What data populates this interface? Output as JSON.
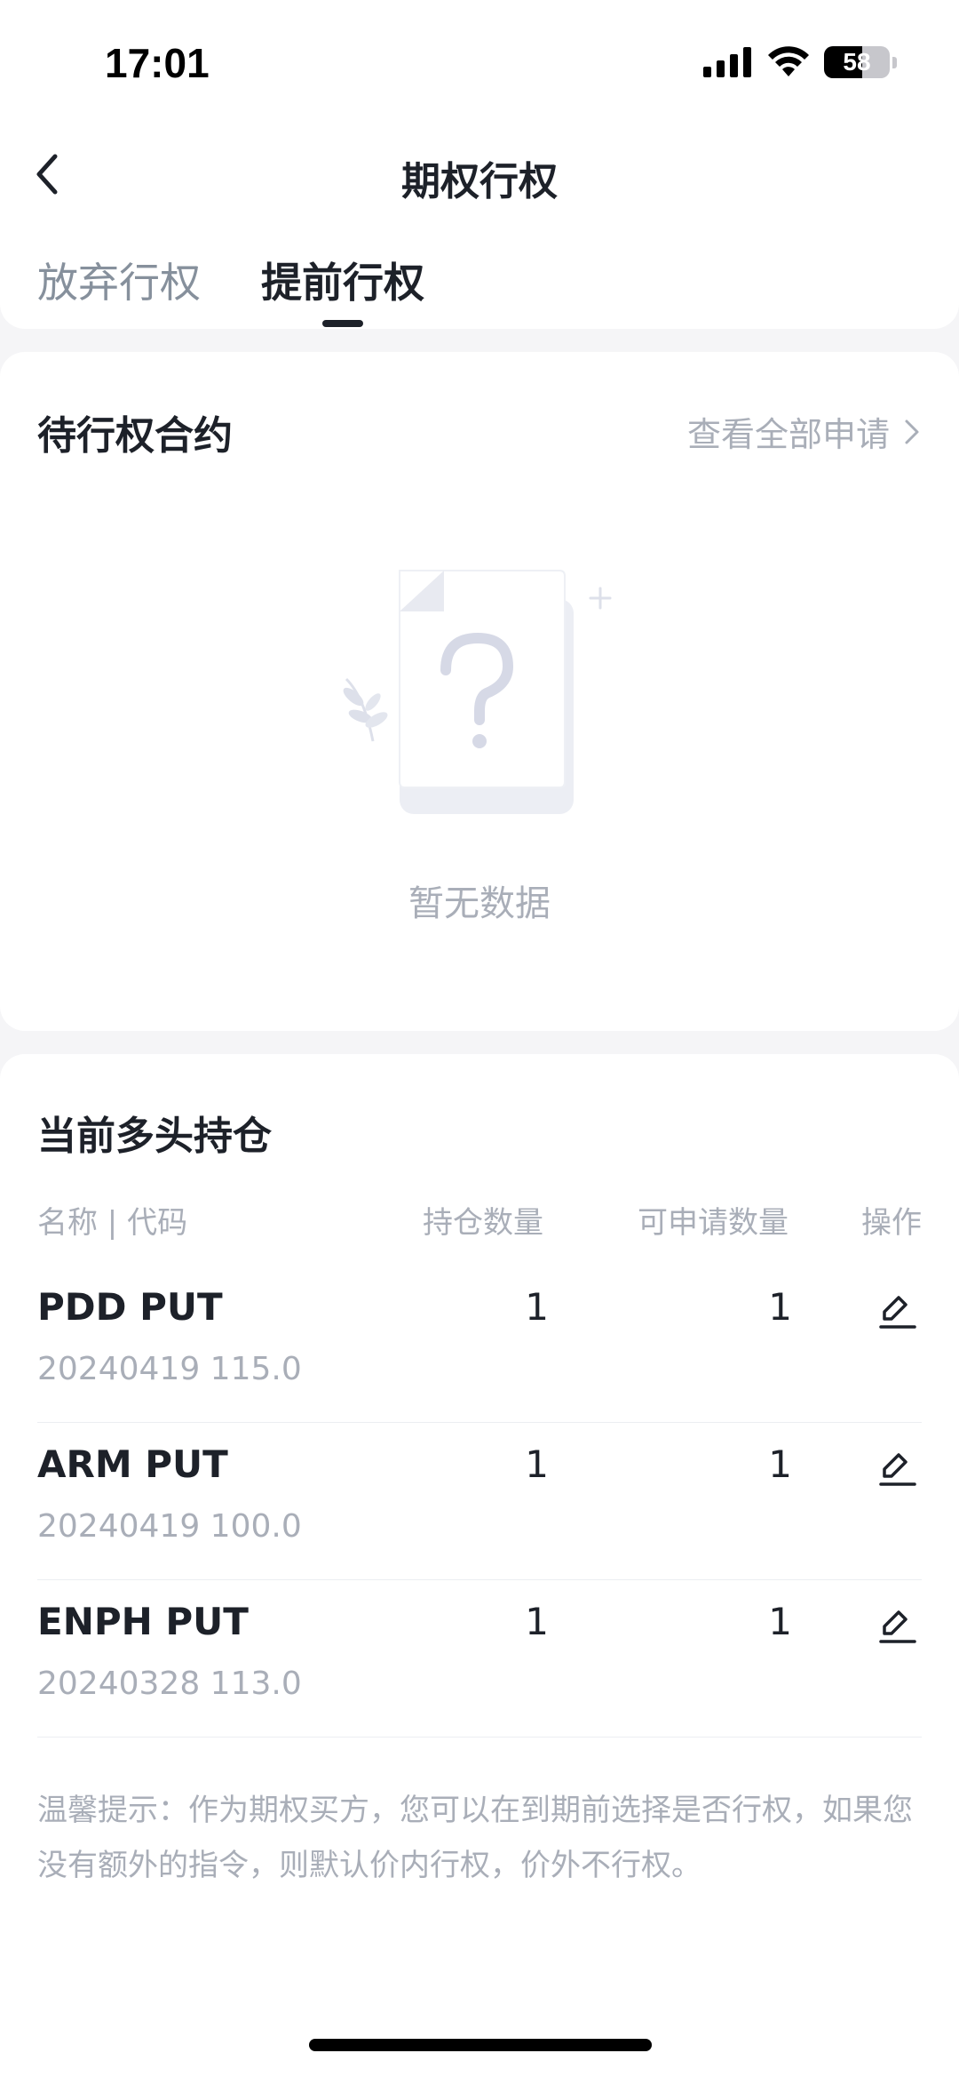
{
  "status_bar": {
    "time": "17:01",
    "battery_level": "58",
    "icons": [
      "cellular-signal-icon",
      "wifi-icon",
      "battery-icon"
    ]
  },
  "header": {
    "title": "期权行权",
    "back_icon": "chevron-left-icon",
    "tabs": [
      {
        "label": "放弃行权",
        "active": false
      },
      {
        "label": "提前行权",
        "active": true
      }
    ]
  },
  "pending": {
    "title": "待行权合约",
    "view_all": "查看全部申请",
    "empty_text": "暂无数据"
  },
  "positions": {
    "title": "当前多头持仓",
    "columns": {
      "name": "名称 | 代码",
      "hold_qty": "持仓数量",
      "apply_qty": "可申请数量",
      "action": "操作"
    },
    "rows": [
      {
        "name": "PDD PUT",
        "code": "20240419 115.0",
        "hold": "1",
        "apply": "1"
      },
      {
        "name": "ARM PUT",
        "code": "20240419 100.0",
        "hold": "1",
        "apply": "1"
      },
      {
        "name": "ENPH PUT",
        "code": "20240328 113.0",
        "hold": "1",
        "apply": "1"
      }
    ],
    "tip": "温馨提示：作为期权买方，您可以在到期前选择是否行权，如果您没有额外的指令，则默认价内行权，价外不行权。"
  },
  "colors": {
    "primary_text": "#1d2129",
    "secondary_text": "#a9aeb8",
    "background": "#f5f5f7"
  }
}
